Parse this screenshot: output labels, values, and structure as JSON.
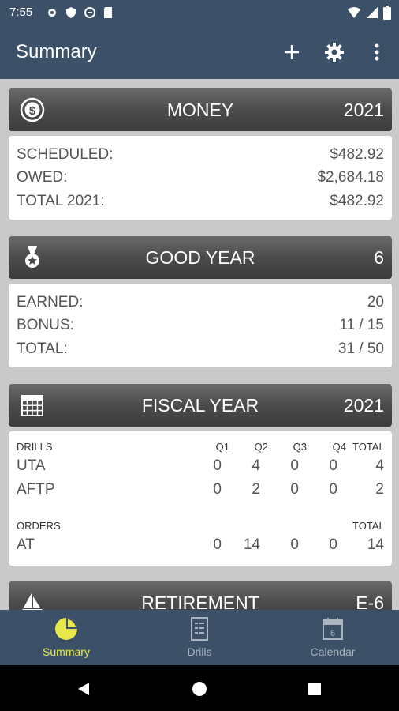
{
  "status": {
    "time": "7:55"
  },
  "appbar": {
    "title": "Summary"
  },
  "money": {
    "title": "MONEY",
    "value": "2021",
    "rows": [
      {
        "label": "SCHEDULED:",
        "value": "$482.92"
      },
      {
        "label": "OWED:",
        "value": "$2,684.18"
      },
      {
        "label": "TOTAL 2021:",
        "value": "$482.92"
      }
    ]
  },
  "good_year": {
    "title": "GOOD YEAR",
    "value": "6",
    "rows": [
      {
        "label": "EARNED:",
        "value": "20"
      },
      {
        "label": "BONUS:",
        "value": "11 / 15"
      },
      {
        "label": "TOTAL:",
        "value": "31 / 50"
      }
    ]
  },
  "fiscal_year": {
    "title": "FISCAL YEAR",
    "value": "2021",
    "drills_header": "DRILLS",
    "cols": [
      "Q1",
      "Q2",
      "Q3",
      "Q4",
      "TOTAL"
    ],
    "drills": [
      {
        "label": "UTA",
        "values": [
          "0",
          "4",
          "0",
          "0",
          "4"
        ]
      },
      {
        "label": "AFTP",
        "values": [
          "0",
          "2",
          "0",
          "0",
          "2"
        ]
      }
    ],
    "orders_header": "ORDERS",
    "orders_total_header": "TOTAL",
    "orders": [
      {
        "label": "AT",
        "values": [
          "0",
          "14",
          "0",
          "0",
          "14"
        ]
      }
    ]
  },
  "retirement": {
    "title": "RETIREMENT",
    "value": "E-6"
  },
  "nav": [
    {
      "label": "Summary",
      "icon": "pie-chart-icon",
      "active": true
    },
    {
      "label": "Drills",
      "icon": "list-document-icon",
      "active": false
    },
    {
      "label": "Calendar",
      "icon": "calendar-icon",
      "active": false
    }
  ],
  "colors": {
    "appbar": "#3c5068",
    "accent": "#e8e84a",
    "nav_inactive": "#aab4bf"
  }
}
